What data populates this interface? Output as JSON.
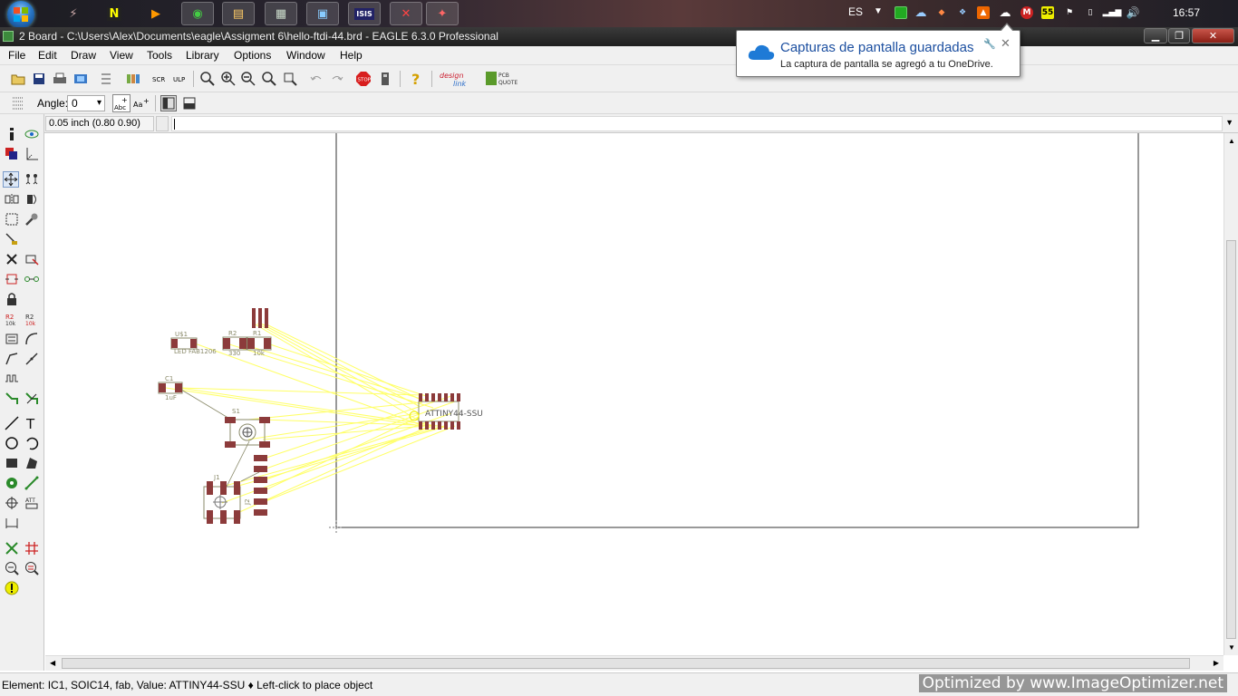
{
  "taskbar": {
    "apps": [
      {
        "name": "winamp",
        "glyph": "⚡",
        "color": "#caa"
      },
      {
        "name": "n-app",
        "glyph": "N",
        "color": "#ff0"
      },
      {
        "name": "media-player",
        "glyph": "▶",
        "color": "#f90"
      },
      {
        "name": "chrome",
        "glyph": "◉",
        "color": "#4c4"
      },
      {
        "name": "explorer",
        "glyph": "▤",
        "color": "#fc6"
      },
      {
        "name": "folder",
        "glyph": "▦",
        "color": "#cdc"
      },
      {
        "name": "monitor",
        "glyph": "▣",
        "color": "#8cf"
      },
      {
        "name": "isis",
        "glyph": "ISIS",
        "color": "#fff"
      },
      {
        "name": "eagle-sch",
        "glyph": "✕",
        "color": "#f44"
      },
      {
        "name": "eagle-brd",
        "glyph": "✦",
        "color": "#f66"
      }
    ],
    "language": "ES",
    "clock": "16:57",
    "tray_icon_55": "55",
    "tray_icon_m": "M"
  },
  "window": {
    "title": "2 Board - C:\\Users\\Alex\\Documents\\eagle\\Assigment 6\\hello-ftdi-44.brd - EAGLE 6.3.0 Professional"
  },
  "menu": [
    "File",
    "Edit",
    "Draw",
    "View",
    "Tools",
    "Library",
    "Options",
    "Window",
    "Help"
  ],
  "toolbar2": {
    "angle_label": "Angle:",
    "angle_value": "0"
  },
  "command": {
    "coordinates": "0.05 inch (0.80 0.90)",
    "input_value": ""
  },
  "notification": {
    "title": "Capturas de pantalla guardadas",
    "message": "La captura de pantalla se agregó a tu OneDrive."
  },
  "board": {
    "components": [
      {
        "name": "U$1",
        "value": "LED FAB1206"
      },
      {
        "name": "R2",
        "value": "330"
      },
      {
        "name": "R1",
        "value": "10k"
      },
      {
        "name": "C1",
        "value": "1uF"
      },
      {
        "name": "S1",
        "value": ""
      },
      {
        "name": "J1",
        "value": ""
      },
      {
        "name": "J2",
        "value": ""
      },
      {
        "name": "IC1",
        "value": "ATTINY44-SSU"
      }
    ],
    "airwire_color": "#ffff66",
    "pad_color": "#8c3b3b"
  },
  "status": {
    "text": "Element: IC1, SOIC14, fab, Value: ATTINY44-SSU  ♦ Left-click to place object",
    "watermark": "Optimized by  www.ImageOptimizer.net"
  }
}
